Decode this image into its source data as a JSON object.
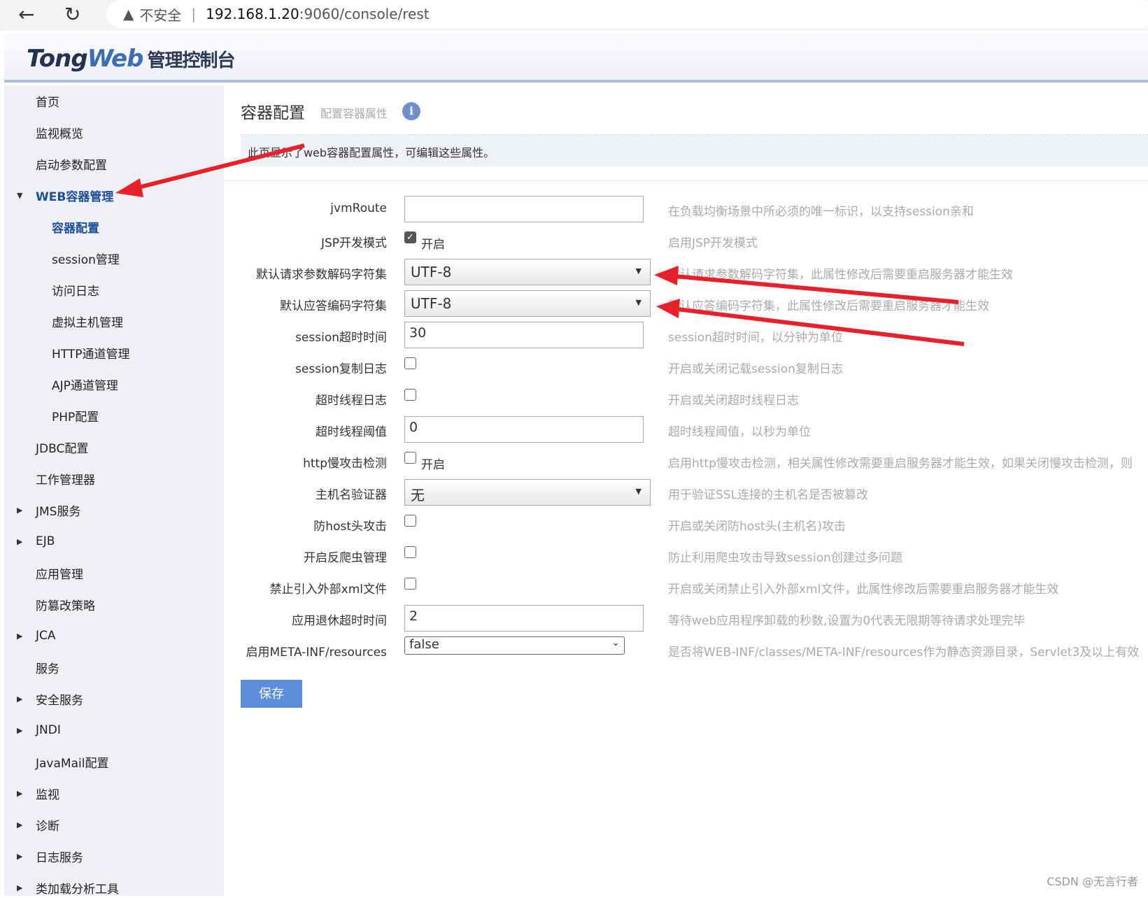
{
  "browser": {
    "insecure": "不安全",
    "url_host": "192.168.1.20",
    "url_path": ":9060/console/rest"
  },
  "header": {
    "logo_tong": "Tong",
    "logo_web": "Web",
    "logo_cn": "管理控制台"
  },
  "sidebar": {
    "items": [
      {
        "label": "首页",
        "level": 0,
        "expander": false
      },
      {
        "label": "监视概览",
        "level": 0,
        "expander": false
      },
      {
        "label": "启动参数配置",
        "level": 0,
        "expander": false
      },
      {
        "label": "WEB容器管理",
        "level": 0,
        "expander": "open",
        "active": true
      },
      {
        "label": "容器配置",
        "level": 1,
        "active": true
      },
      {
        "label": "session管理",
        "level": 1
      },
      {
        "label": "访问日志",
        "level": 1
      },
      {
        "label": "虚拟主机管理",
        "level": 1
      },
      {
        "label": "HTTP通道管理",
        "level": 1
      },
      {
        "label": "AJP通道管理",
        "level": 1
      },
      {
        "label": "PHP配置",
        "level": 1
      },
      {
        "label": "JDBC配置",
        "level": 0
      },
      {
        "label": "工作管理器",
        "level": 0
      },
      {
        "label": "JMS服务",
        "level": 0,
        "expander": "closed"
      },
      {
        "label": "EJB",
        "level": 0,
        "expander": "closed"
      },
      {
        "label": "应用管理",
        "level": 0
      },
      {
        "label": "防篡改策略",
        "level": 0
      },
      {
        "label": "JCA",
        "level": 0,
        "expander": "closed"
      },
      {
        "label": "服务",
        "level": 0
      },
      {
        "label": "安全服务",
        "level": 0,
        "expander": "closed"
      },
      {
        "label": "JNDI",
        "level": 0,
        "expander": "closed"
      },
      {
        "label": "JavaMail配置",
        "level": 0
      },
      {
        "label": "监视",
        "level": 0,
        "expander": "closed"
      },
      {
        "label": "诊断",
        "level": 0,
        "expander": "closed"
      },
      {
        "label": "日志服务",
        "level": 0,
        "expander": "closed"
      },
      {
        "label": "类加载分析工具",
        "level": 0,
        "expander": "closed"
      }
    ]
  },
  "page": {
    "title": "容器配置",
    "subtitle": "配置容器属性",
    "info_icon": "i",
    "notice": "此页显示了web容器配置属性，可编辑这些属性。",
    "save_label": "保存"
  },
  "form": [
    {
      "label": "jvmRoute",
      "type": "text",
      "value": "",
      "desc": "在负载均衡场景中所必须的唯一标识，以支持session亲和"
    },
    {
      "label": "JSP开发模式",
      "type": "checkbox",
      "checked": true,
      "cb_label": "开启",
      "desc": "启用JSP开发模式"
    },
    {
      "label": "默认请求参数解码字符集",
      "type": "select",
      "value": "UTF-8",
      "desc": "默认请求参数解码字符集，此属性修改后需要重启服务器才能生效"
    },
    {
      "label": "默认应答编码字符集",
      "type": "select",
      "value": "UTF-8",
      "desc": "默认应答编码字符集，此属性修改后需要重启服务器才能生效"
    },
    {
      "label": "session超时时间",
      "type": "text",
      "value": "30",
      "desc": "session超时时间，以分钟为单位"
    },
    {
      "label": "session复制日志",
      "type": "checkbox",
      "checked": false,
      "desc": "开启或关闭记载session复制日志"
    },
    {
      "label": "超时线程日志",
      "type": "checkbox",
      "checked": false,
      "desc": "开启或关闭超时线程日志"
    },
    {
      "label": "超时线程阈值",
      "type": "text",
      "value": "0",
      "desc": "超时线程阈值，以秒为单位"
    },
    {
      "label": "http慢攻击检测",
      "type": "checkbox",
      "checked": false,
      "cb_label": "开启",
      "desc": "启用http慢攻击检测，相关属性修改需要重启服务器才能生效，如果关闭慢攻击检测，则"
    },
    {
      "label": "主机名验证器",
      "type": "select",
      "value": "无",
      "desc": "用于验证SSL连接的主机名是否被篡改"
    },
    {
      "label": "防host头攻击",
      "type": "checkbox",
      "checked": false,
      "desc": "开启或关闭防host头(主机名)攻击"
    },
    {
      "label": "开启反爬虫管理",
      "type": "checkbox",
      "checked": false,
      "desc": "防止利用爬虫攻击导致session创建过多问题"
    },
    {
      "label": "禁止引入外部xml文件",
      "type": "checkbox",
      "checked": false,
      "desc": "开启或关闭禁止引入外部xml文件，此属性修改后需要重启服务器才能生效"
    },
    {
      "label": "应用退休超时时间",
      "type": "text",
      "value": "2",
      "desc": "等待web应用程序卸载的秒数,设置为0代表无限期等待请求处理完毕"
    },
    {
      "label": "启用META-INF/resources",
      "type": "native-select",
      "value": "false",
      "desc": "是否将WEB-INF/classes/META-INF/resources作为静态资源目录，Servlet3及以上有效"
    }
  ],
  "watermark": "CSDN @无言行者",
  "colors": {
    "accent": "#5b8fdb",
    "active_nav": "#1d4e9e",
    "annotation": "#e8202a"
  }
}
